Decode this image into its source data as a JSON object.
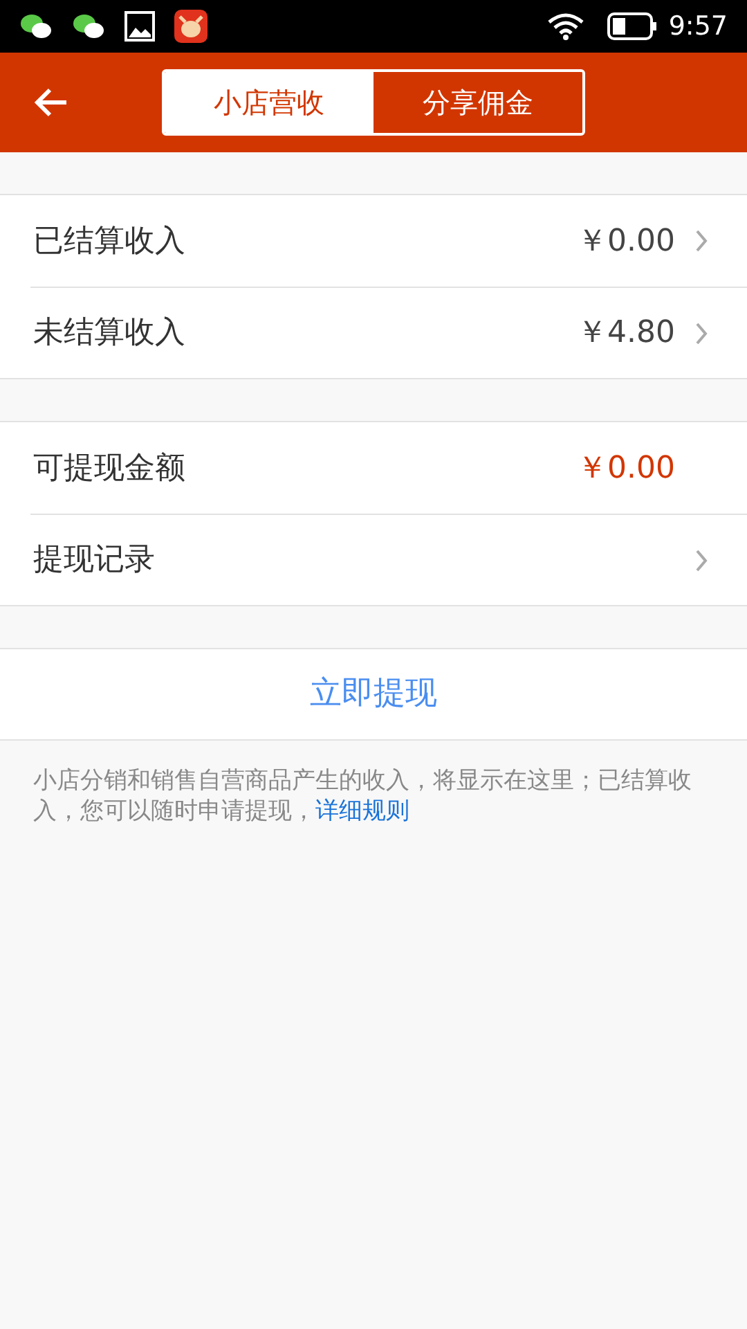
{
  "status_bar": {
    "time": "9:57"
  },
  "header": {
    "tabs": [
      {
        "label": "小店营收",
        "selected": true
      },
      {
        "label": "分享佣金",
        "selected": false
      }
    ]
  },
  "groups": [
    {
      "rows": [
        {
          "label": "已结算收入",
          "value": "￥0.00",
          "highlight": false,
          "chevron": true
        },
        {
          "label": "未结算收入",
          "value": "￥4.80",
          "highlight": false,
          "chevron": true
        }
      ]
    },
    {
      "rows": [
        {
          "label": "可提现金额",
          "value": "￥0.00",
          "highlight": true,
          "chevron": false
        },
        {
          "label": "提现记录",
          "chevron": true
        }
      ]
    }
  ],
  "withdraw_button": "立即提现",
  "note": {
    "text": "小店分销和销售自营商品产生的收入，将显示在这里；已结算收入，您可以随时申请提现，",
    "link": "详细规则"
  }
}
